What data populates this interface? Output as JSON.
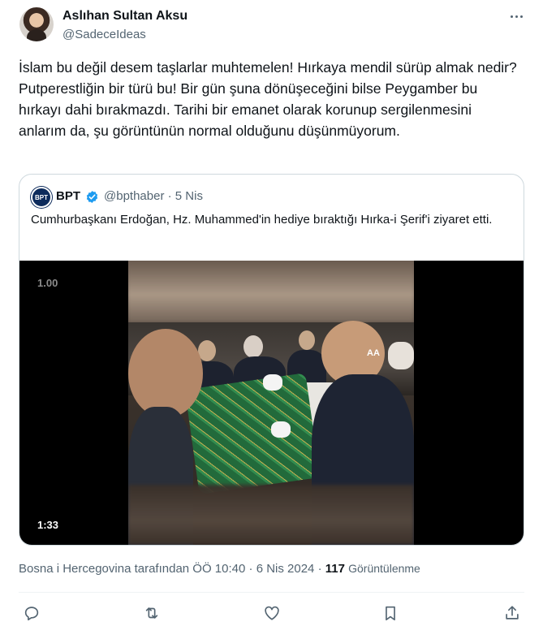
{
  "author": {
    "name": "Aslıhan Sultan Aksu",
    "handle": "@SadeceIdeas"
  },
  "tweet": {
    "text": "İslam bu değil desem taşlarlar muhtemelen! Hırkaya mendil sürüp almak nedir? Putperestliğin bir türü bu! Bir gün şuna dönüşeceğini bilse Peygamber bu hırkayı dahi bırakmazdı. Tarihi bir emanet olarak korunup sergilenmesini anlarım da, şu görüntünün normal olduğunu düşünmüyorum."
  },
  "quote": {
    "avatar_text": "BPT",
    "name": "BPT",
    "handle": "@bpthaber",
    "separator": "·",
    "date": "5 Nis",
    "text": "Cumhurbaşkanı Erdoğan, Hz. Muhammed'in hediye bıraktığı Hırka-i Şerif'i ziyaret etti.",
    "video": {
      "playback_rate": "1.00",
      "duration": "1:33",
      "watermark": "AA"
    }
  },
  "meta": {
    "translation": "Bosna i Hercegovina tarafından ÖÖ 10:40",
    "separator": "·",
    "date": "6 Nis 2024",
    "separator2": "·",
    "views_count": "117",
    "views_label": "Görüntülenme"
  },
  "icons": {
    "more": "more-horizontal-icon",
    "verified": "verified-badge-icon",
    "reply": "reply-icon",
    "retweet": "retweet-icon",
    "like": "like-icon",
    "bookmark": "bookmark-icon",
    "share": "share-icon"
  },
  "colors": {
    "text": "#0f1419",
    "secondary": "#536471",
    "border": "#cfd9de",
    "verified": "#1d9bf0"
  }
}
